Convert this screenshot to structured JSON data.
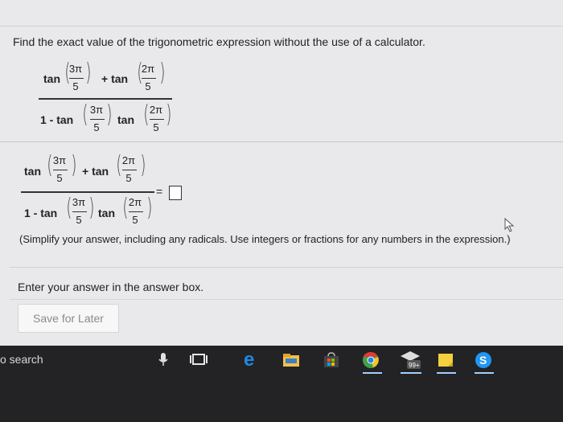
{
  "question": {
    "prompt": "Find the exact value of the trigonometric expression without the use of a calculator.",
    "instruction": "(Simplify your answer, including any radicals. Use integers or fractions for any numbers in the expression.)",
    "answer_box_hint": "Enter your answer in the answer box."
  },
  "expression": {
    "tan": "tan",
    "plus_tan": "+ tan",
    "one_minus_tan": "1 - tan",
    "num_3pi": "3π",
    "num_2pi": "2π",
    "den_5": "5",
    "equals": "="
  },
  "buttons": {
    "save_for_later": "Save for Later"
  },
  "taskbar": {
    "search_label": "o search",
    "store_badge": "99+"
  },
  "colors": {
    "screen_bg": "#e9e9eb",
    "taskbar_bg": "#232224",
    "edge_blue": "#1e88e5",
    "chrome_colors": [
      "#e53935",
      "#fbc02d",
      "#43a047"
    ]
  }
}
